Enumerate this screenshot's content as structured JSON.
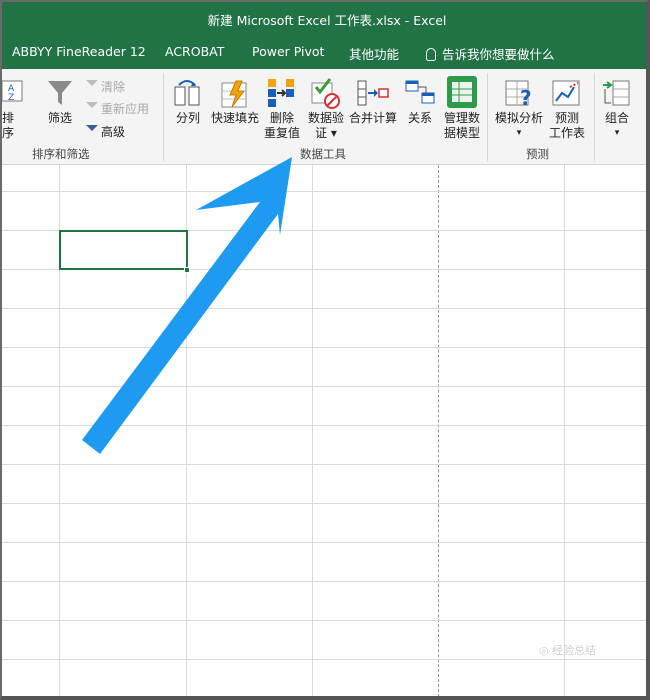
{
  "window": {
    "title": "新建 Microsoft Excel 工作表.xlsx  -  Excel"
  },
  "menu": {
    "items": [
      "ABBYY FineReader 12",
      "ACROBAT",
      "Power Pivot",
      "其他功能"
    ],
    "tell_me": "告诉我你想要做什么"
  },
  "ribbon": {
    "sort_filter": {
      "sort_label": "排序",
      "filter_label": "筛选",
      "clear_label": "清除",
      "reapply_label": "重新应用",
      "advanced_label": "高级",
      "group_label": "排序和筛选"
    },
    "data_tools": {
      "text_to_columns": "分列",
      "flash_fill": "快速填充",
      "remove_dup_1": "删除",
      "remove_dup_2": "重复值",
      "validation_1": "数据验",
      "validation_2": "证 ▾",
      "consolidate": "合并计算",
      "relationships": "关系",
      "data_model_1": "管理数",
      "data_model_2": "据模型",
      "group_label": "数据工具"
    },
    "forecast": {
      "what_if_1": "模拟分析",
      "what_if_2": "▾",
      "forecast_sheet_1": "预测",
      "forecast_sheet_2": "工作表",
      "group_label": "预测"
    },
    "outline": {
      "group_1": "组合",
      "group_2": "▾"
    }
  },
  "colors": {
    "excel_green": "#217346",
    "arrow_blue": "#1e9bf0"
  },
  "watermark": "◎ 经验总结"
}
